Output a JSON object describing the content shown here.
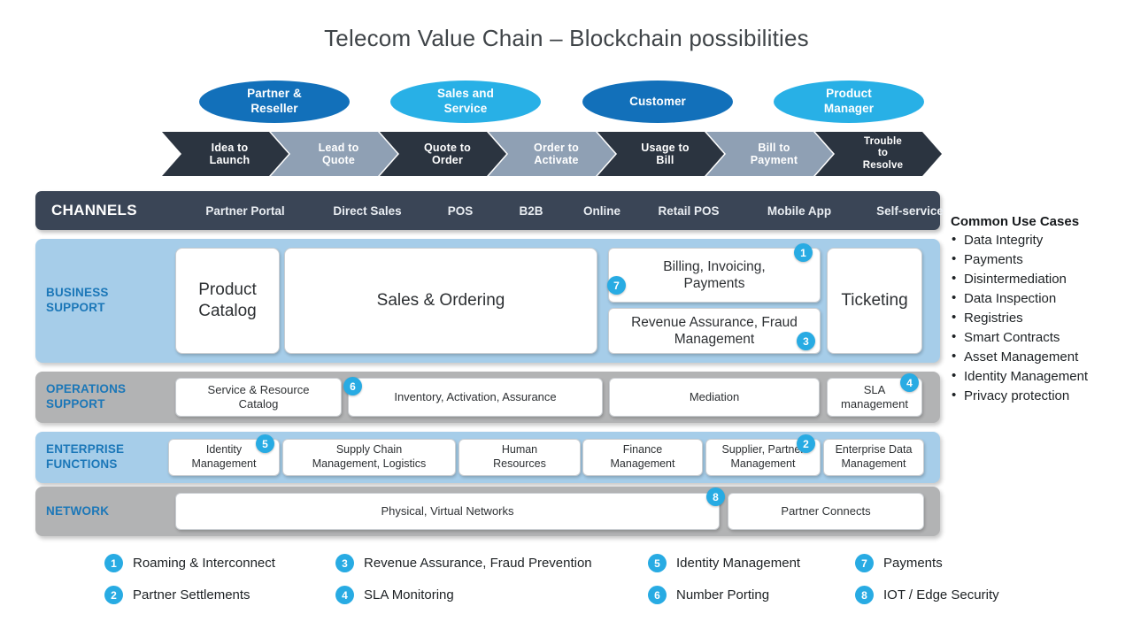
{
  "header": {
    "title": "Telecom Value Chain – Blockchain possibilities"
  },
  "actors": [
    {
      "label": "Partner & Reseller",
      "line1": "Partner &",
      "line2": "Reseller",
      "tone": "dark",
      "color": "#1270ba"
    },
    {
      "label": "Sales and Service",
      "line1": "Sales and",
      "line2": "Service",
      "tone": "light",
      "color": "#28b0e6"
    },
    {
      "label": "Customer",
      "line1": "Customer",
      "line2": "",
      "tone": "dark",
      "color": "#1270ba"
    },
    {
      "label": "Product Manager",
      "line1": "Product",
      "line2": "Manager",
      "tone": "light",
      "color": "#28b0e6"
    }
  ],
  "process_stages": [
    {
      "label": "Idea to Launch",
      "line1": "Idea to",
      "line2": "Launch",
      "line3": "",
      "tone": "dark"
    },
    {
      "label": "Lead to Quote",
      "line1": "Lead to",
      "line2": "Quote",
      "line3": "",
      "tone": "gray"
    },
    {
      "label": "Quote to Order",
      "line1": "Quote to",
      "line2": "Order",
      "line3": "",
      "tone": "dark"
    },
    {
      "label": "Order to Activate",
      "line1": "Order to",
      "line2": "Activate",
      "line3": "",
      "tone": "gray"
    },
    {
      "label": "Usage to Bill",
      "line1": "Usage to",
      "line2": "Bill",
      "line3": "",
      "tone": "dark"
    },
    {
      "label": "Bill to Payment",
      "line1": "Bill to",
      "line2": "Payment",
      "line3": "",
      "tone": "gray"
    },
    {
      "label": "Trouble to Resolve",
      "line1": "Trouble",
      "line2": "to",
      "line3": "Resolve",
      "tone": "dark"
    }
  ],
  "channels": {
    "title": "CHANNELS",
    "bar_color": "#3a4556",
    "items": [
      "Partner Portal",
      "Direct Sales",
      "POS",
      "B2B",
      "Online",
      "Retail POS",
      "Mobile App",
      "Self-service"
    ]
  },
  "layers": [
    {
      "name": "business-support",
      "label_line1": "BUSINESS",
      "label_line2": "SUPPORT",
      "tone": "blue",
      "bg": "#a6cde9",
      "boxes": [
        {
          "text": "Product Catalog",
          "line1": "Product",
          "line2": "Catalog"
        },
        {
          "text": "Sales & Ordering",
          "line1": "Sales & Ordering",
          "line2": ""
        },
        {
          "text": "Billing, Invoicing, Payments",
          "line1": "Billing, Invoicing,",
          "line2": "Payments"
        },
        {
          "text": "Revenue Assurance, Fraud Management",
          "line1": "Revenue Assurance, Fraud",
          "line2": "Management"
        },
        {
          "text": "Ticketing",
          "line1": "Ticketing",
          "line2": ""
        }
      ]
    },
    {
      "name": "operations-support",
      "label_line1": "OPERATIONS",
      "label_line2": "SUPPORT",
      "tone": "gray",
      "bg": "#b2b3b4",
      "boxes": [
        {
          "text": "Service & Resource Catalog",
          "line1": "Service & Resource",
          "line2": "Catalog"
        },
        {
          "text": "Inventory, Activation, Assurance",
          "line1": "Inventory, Activation, Assurance",
          "line2": ""
        },
        {
          "text": "Mediation",
          "line1": "Mediation",
          "line2": ""
        },
        {
          "text": "SLA management",
          "line1": "SLA",
          "line2": "management"
        }
      ]
    },
    {
      "name": "enterprise-functions",
      "label_line1": "ENTERPRISE",
      "label_line2": "FUNCTIONS",
      "tone": "blue",
      "bg": "#a6cde9",
      "boxes": [
        {
          "text": "Identity Management",
          "line1": "Identity",
          "line2": "Management"
        },
        {
          "text": "Supply Chain Management, Logistics",
          "line1": "Supply Chain",
          "line2": "Management, Logistics"
        },
        {
          "text": "Human Resources",
          "line1": "Human",
          "line2": "Resources"
        },
        {
          "text": "Finance Management",
          "line1": "Finance",
          "line2": "Management"
        },
        {
          "text": "Supplier, Partner Management",
          "line1": "Supplier, Partner",
          "line2": "Management"
        },
        {
          "text": "Enterprise Data Management",
          "line1": "Enterprise Data",
          "line2": "Management"
        }
      ]
    },
    {
      "name": "network",
      "label_line1": "NETWORK",
      "label_line2": "",
      "tone": "gray",
      "bg": "#b2b3b4",
      "boxes": [
        {
          "text": "Physical, Virtual Networks",
          "line1": "Physical, Virtual Networks",
          "line2": ""
        },
        {
          "text": "Partner Connects",
          "line1": "Partner Connects",
          "line2": ""
        }
      ]
    }
  ],
  "diagram_badges": [
    {
      "number": "1",
      "on": "billing-invoicing-payments"
    },
    {
      "number": "7",
      "on": "billing-invoicing-payments"
    },
    {
      "number": "3",
      "on": "revenue-assurance-fraud-management"
    },
    {
      "number": "6",
      "on": "inventory-activation-assurance"
    },
    {
      "number": "4",
      "on": "sla-management"
    },
    {
      "number": "5",
      "on": "identity-management"
    },
    {
      "number": "2",
      "on": "supplier-partner-management"
    },
    {
      "number": "8",
      "on": "physical-virtual-networks"
    }
  ],
  "use_cases": {
    "title": "Common Use Cases",
    "items": [
      "Data Integrity",
      "Payments",
      "Disintermediation",
      "Data Inspection",
      "Registries",
      "Smart Contracts",
      "Asset Management",
      "Identity Management",
      "Privacy protection"
    ]
  },
  "legend": {
    "badge_color": "#28abe3",
    "items": [
      {
        "number": "1",
        "label": "Roaming & Interconnect"
      },
      {
        "number": "2",
        "label": "Partner Settlements"
      },
      {
        "number": "3",
        "label": "Revenue Assurance, Fraud Prevention"
      },
      {
        "number": "4",
        "label": "SLA Monitoring"
      },
      {
        "number": "5",
        "label": "Identity Management"
      },
      {
        "number": "6",
        "label": "Number Porting"
      },
      {
        "number": "7",
        "label": "Payments"
      },
      {
        "number": "8",
        "label": "IOT / Edge Security"
      }
    ]
  }
}
